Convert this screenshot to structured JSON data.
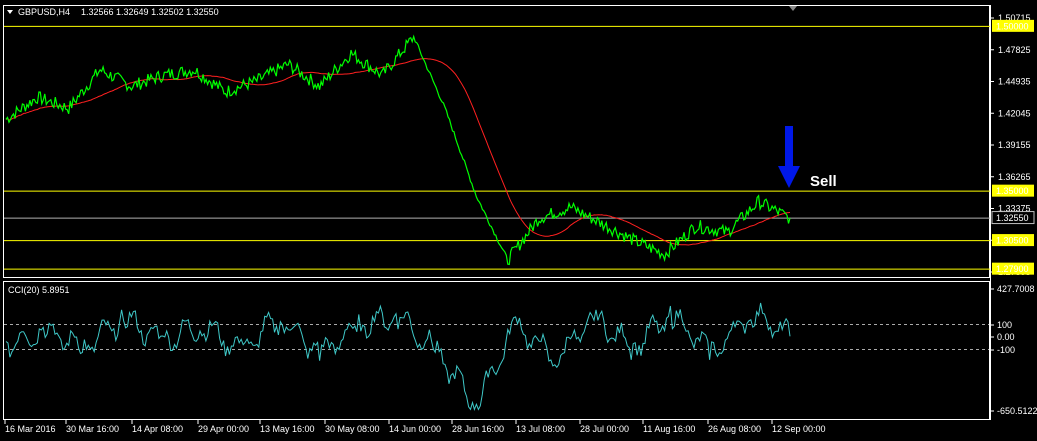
{
  "header": {
    "dropdown_icon": "triangle-down-icon",
    "symbol": "GBPUSD,H4",
    "ohlc": "1.32566 1.32649 1.32502 1.32550"
  },
  "indicator": {
    "label": "CCI(20) 5.8951",
    "axis_labels": [
      "427.7008",
      "100",
      "0.00",
      "-100",
      "-650.5122"
    ]
  },
  "annotation": {
    "arrow_icon": "down-arrow-icon",
    "arrow_color": "#0018e8",
    "text": "Sell"
  },
  "colors": {
    "background": "#000000",
    "price_line": "#00ff00",
    "moving_average": "#ff2020",
    "level_line": "#ffff00",
    "cci_line": "#3fc8c8",
    "axis": "#ffffff"
  },
  "price_axis": {
    "labels": [
      "1.50715",
      "1.47825",
      "1.44935",
      "1.42045",
      "1.39155",
      "1.36265",
      "1.33375",
      "1.30485",
      "1.27595"
    ],
    "highlighted": [
      {
        "value": "1.50000",
        "level": 1.5,
        "style": "yellow"
      },
      {
        "value": "1.35000",
        "level": 1.35,
        "style": "yellow"
      },
      {
        "value": "1.32550",
        "level": 1.3255,
        "style": "current"
      },
      {
        "value": "1.30500",
        "level": 1.305,
        "style": "yellow"
      },
      {
        "value": "1.27900",
        "level": 1.279,
        "style": "yellow"
      }
    ]
  },
  "time_axis": {
    "labels": [
      "16 Mar 2016",
      "30 Mar 16:00",
      "14 Apr 08:00",
      "29 Apr 00:00",
      "13 May 16:00",
      "30 May 08:00",
      "14 Jun 00:00",
      "28 Jun 16:00",
      "13 Jul 08:00",
      "28 Jul 00:00",
      "11 Aug 16:00",
      "26 Aug 08:00",
      "12 Sep 00:00"
    ]
  },
  "chart_data": {
    "type": "line",
    "series": [
      {
        "name": "GBPUSD,H4",
        "x": [
          0,
          4,
          8,
          12,
          16,
          20,
          24,
          28,
          32,
          36,
          40,
          44,
          48,
          52,
          56,
          60,
          64,
          68,
          72,
          76,
          80,
          84,
          88,
          92,
          96,
          100
        ],
        "values": [
          1.415,
          1.435,
          1.425,
          1.46,
          1.445,
          1.455,
          1.46,
          1.44,
          1.45,
          1.465,
          1.445,
          1.475,
          1.455,
          1.49,
          1.425,
          1.345,
          1.287,
          1.325,
          1.335,
          1.32,
          1.305,
          1.292,
          1.318,
          1.312,
          1.34,
          1.325
        ]
      },
      {
        "name": "CCI(20)",
        "x": [
          0,
          5,
          10,
          15,
          20,
          25,
          30,
          35,
          40,
          45,
          50,
          55,
          60,
          65,
          70,
          75,
          80,
          85,
          90,
          95,
          100
        ],
        "values": [
          -60,
          60,
          -100,
          170,
          -40,
          120,
          -130,
          180,
          -160,
          100,
          200,
          -150,
          -600,
          100,
          -180,
          150,
          -80,
          200,
          -160,
          230,
          6
        ]
      }
    ],
    "ylim": [
      1.27595,
      1.50715
    ],
    "cci_ylim": [
      -650.5122,
      427.7008
    ]
  }
}
